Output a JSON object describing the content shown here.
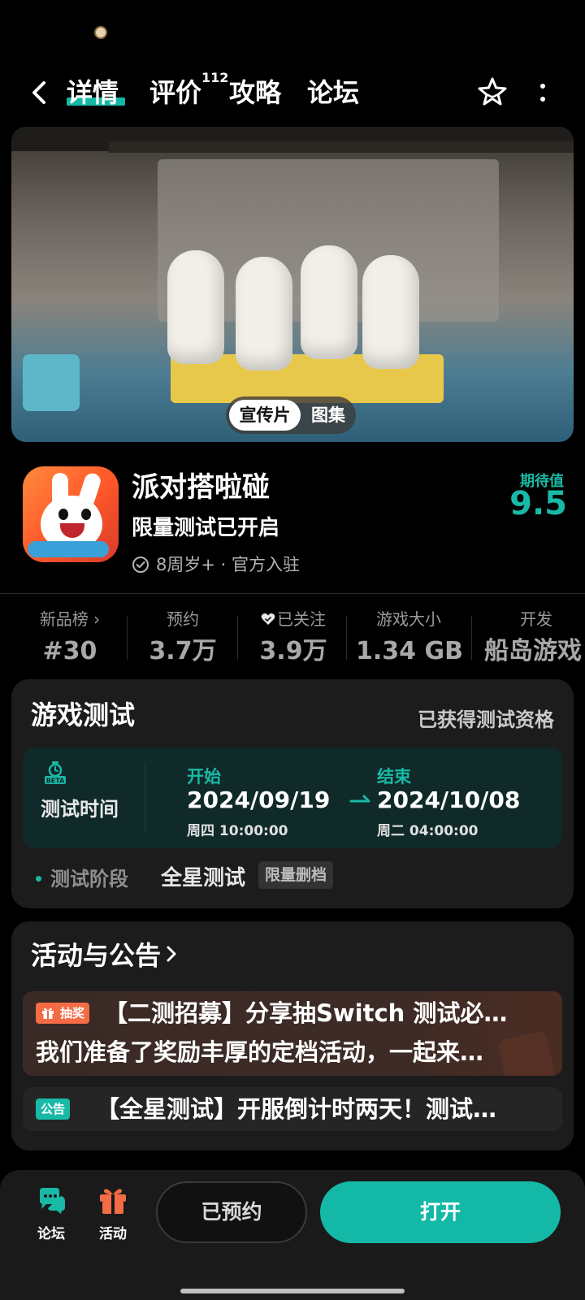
{
  "nav": {
    "tabs": [
      {
        "label": "详情",
        "active": true
      },
      {
        "label": "评价",
        "count": "112"
      },
      {
        "label": "攻略"
      },
      {
        "label": "论坛"
      }
    ],
    "icons": [
      "back-icon",
      "star-icon",
      "more-icon"
    ]
  },
  "banner": {
    "media_tabs": {
      "active": "宣传片",
      "other": "图集"
    }
  },
  "app": {
    "title": "派对搭啦碰",
    "subtitle": "限量测试已开启",
    "meta": "8周岁+ · 官方入驻",
    "expect_label": "期待值",
    "expect_value": "9.5"
  },
  "stats": [
    {
      "label": "新品榜 ›",
      "value": "#30"
    },
    {
      "label": "预约",
      "value": "3.7万"
    },
    {
      "label": "已关注",
      "value": "3.9万",
      "icon": "heart-icon"
    },
    {
      "label": "游戏大小",
      "value": "1.34 GB"
    },
    {
      "label": "开发",
      "value": "船岛游戏"
    }
  ],
  "game_test": {
    "title": "游戏测试",
    "status": "已获得测试资格",
    "time_label": "测试时间",
    "start_label": "开始",
    "start_date": "2024/09/19",
    "start_sub": "周四  10:00:00",
    "end_label": "结束",
    "end_date": "2024/10/08",
    "end_sub": "周二  04:00:00",
    "stage_label": "测试阶段",
    "stage_value": "全星测试",
    "stage_badge": "限量删档",
    "beta_text": "BETA"
  },
  "activity": {
    "title": "活动与公告",
    "items": [
      {
        "badge": "抽奖",
        "title": "【二测招募】分享抽Switch 测试必…",
        "desc": "我们准备了奖励丰厚的定档活动，一起来…"
      },
      {
        "badge": "公告",
        "title": "【全星测试】开服倒计时两天！测试…"
      }
    ]
  },
  "bottom_bar": {
    "forum_label": "论坛",
    "events_label": "活动",
    "reserved_label": "已预约",
    "open_label": "打开"
  },
  "colors": {
    "accent": "#14b8a6",
    "background": "#000000",
    "card": "#1c1c1c",
    "lottery_badge": "#f36c45"
  }
}
